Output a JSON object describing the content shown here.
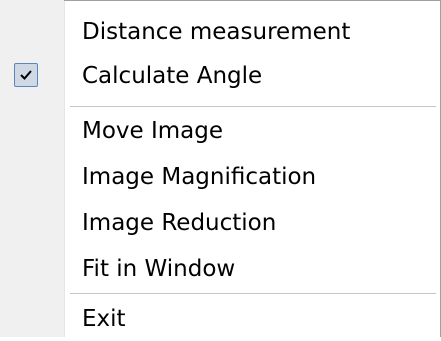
{
  "menu": {
    "items": [
      {
        "label": "Distance measurement",
        "checked": false
      },
      {
        "label": "Calculate Angle",
        "checked": true
      },
      {
        "label": "Move Image",
        "checked": false
      },
      {
        "label": "Image Magnification",
        "checked": false
      },
      {
        "label": "Image Reduction",
        "checked": false
      },
      {
        "label": "Fit in Window",
        "checked": false
      },
      {
        "label": "Exit",
        "checked": false
      }
    ]
  },
  "colors": {
    "gutter": "#f0f0f0",
    "checkbox_fill": "#cfd9e6",
    "checkbox_border": "#5c86b8",
    "separator": "#c5c5c5"
  },
  "icons": {
    "check": "checkmark-icon"
  }
}
